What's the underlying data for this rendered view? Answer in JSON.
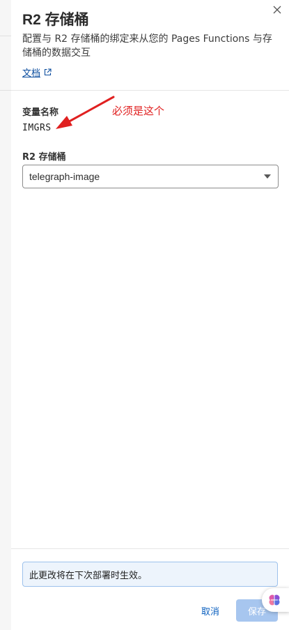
{
  "panel": {
    "title": "R2 存储桶",
    "description": "配置与 R2 存储桶的绑定来从您的 Pages Functions 与存储桶的数据交互",
    "docs_link": "文档"
  },
  "variable": {
    "label": "变量名称",
    "value": "IMGRS"
  },
  "annotation": {
    "text": "必须是这个",
    "color": "#e02020"
  },
  "bucket": {
    "label": "R2 存储桶",
    "selected": "telegraph-image"
  },
  "notice": {
    "text": "此更改将在下次部署时生效。"
  },
  "footer": {
    "cancel_label": "取消",
    "save_label": "保存"
  },
  "colors": {
    "link": "#0a4c9e",
    "primary_disabled": "#a7c6ef",
    "notice_bg": "#edf4fc",
    "notice_border": "#9cc1ec"
  },
  "icons": {
    "close": "close-icon",
    "external": "external-link-icon",
    "dropdown": "caret-down-icon",
    "assistant": "brain-icon"
  }
}
